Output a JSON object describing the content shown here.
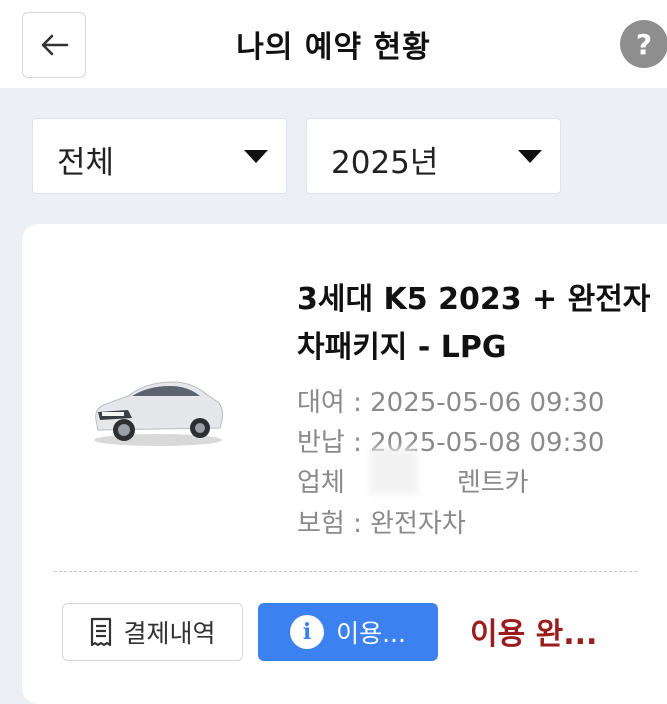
{
  "header": {
    "title": "나의 예약 현황",
    "back_icon": "arrow-left-icon",
    "help_label": "?",
    "help_icon": "help-circle-icon"
  },
  "filters": {
    "category": {
      "selected": "전체"
    },
    "year": {
      "selected": "2025년"
    }
  },
  "reservation": {
    "car_title_line1": "3세대 K5 2023 + 완전자",
    "car_title_line2": "차패키지 - LPG",
    "car_image_icon": "car-photo",
    "rent_line": "대여 : 2025-05-06 09:30",
    "return_line": "반납 : 2025-05-08 09:30",
    "company_label": "업체",
    "company_name": "렌트카",
    "insurance_line": "보험 : 완전자차",
    "receipt_button": "결제내역",
    "receipt_icon": "receipt-icon",
    "info_button": "이용...",
    "info_icon": "info-icon",
    "status_text": "이용 완..."
  },
  "colors": {
    "accent_blue": "#3b82f0",
    "status_red": "#9b1c1c",
    "background": "#eceff4"
  }
}
